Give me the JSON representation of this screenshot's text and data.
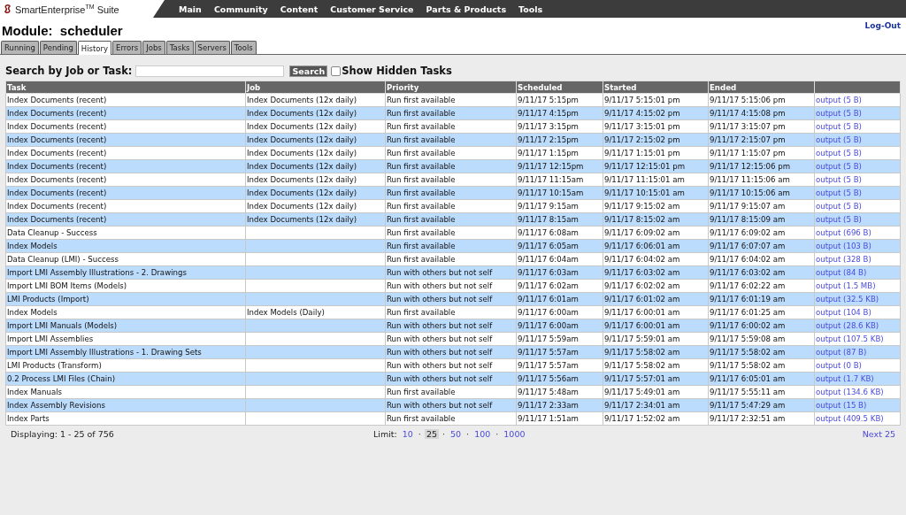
{
  "brand": "SmartEnterprise$^{TM}$ Suite",
  "nav": [
    "Main",
    "Community",
    "Content",
    "Customer Service",
    "Parts & Products",
    "Tools"
  ],
  "module_title": "Module:  scheduler",
  "logout": "Log-Out",
  "tabs": [
    {
      "label": "Running",
      "selected": false
    },
    {
      "label": "Pending",
      "selected": false
    },
    {
      "label": "History",
      "selected": true
    },
    {
      "label": "Errors",
      "selected": false
    },
    {
      "label": "Jobs",
      "selected": false
    },
    {
      "label": "Tasks",
      "selected": false
    },
    {
      "label": "Servers",
      "selected": false
    },
    {
      "label": "Tools",
      "selected": false
    }
  ],
  "search": {
    "label": "Search by Job or Task:",
    "button": "Search",
    "hidden_label": "Show Hidden Tasks",
    "show_hidden": false
  },
  "table": {
    "columns": [
      "Task",
      "Job",
      "Priority",
      "Scheduled",
      "Started",
      "Ended"
    ],
    "rows": [
      {
        "task": "Index Documents (recent)",
        "job": "Index Documents (12x daily)",
        "priority": "Run first available",
        "scheduled": "9/11/17 5:15pm",
        "started": "9/11/17 5:15:01 pm",
        "ended": "9/11/17 5:15:06 pm",
        "output": "output (5 B)"
      },
      {
        "task": "Index Documents (recent)",
        "job": "Index Documents (12x daily)",
        "priority": "Run first available",
        "scheduled": "9/11/17 4:15pm",
        "started": "9/11/17 4:15:02 pm",
        "ended": "9/11/17 4:15:08 pm",
        "output": "output (5 B)"
      },
      {
        "task": "Index Documents (recent)",
        "job": "Index Documents (12x daily)",
        "priority": "Run first available",
        "scheduled": "9/11/17 3:15pm",
        "started": "9/11/17 3:15:01 pm",
        "ended": "9/11/17 3:15:07 pm",
        "output": "output (5 B)"
      },
      {
        "task": "Index Documents (recent)",
        "job": "Index Documents (12x daily)",
        "priority": "Run first available",
        "scheduled": "9/11/17 2:15pm",
        "started": "9/11/17 2:15:02 pm",
        "ended": "9/11/17 2:15:07 pm",
        "output": "output (5 B)"
      },
      {
        "task": "Index Documents (recent)",
        "job": "Index Documents (12x daily)",
        "priority": "Run first available",
        "scheduled": "9/11/17 1:15pm",
        "started": "9/11/17 1:15:01 pm",
        "ended": "9/11/17 1:15:07 pm",
        "output": "output (5 B)"
      },
      {
        "task": "Index Documents (recent)",
        "job": "Index Documents (12x daily)",
        "priority": "Run first available",
        "scheduled": "9/11/17 12:15pm",
        "started": "9/11/17 12:15:01 pm",
        "ended": "9/11/17 12:15:06 pm",
        "output": "output (5 B)"
      },
      {
        "task": "Index Documents (recent)",
        "job": "Index Documents (12x daily)",
        "priority": "Run first available",
        "scheduled": "9/11/17 11:15am",
        "started": "9/11/17 11:15:01 am",
        "ended": "9/11/17 11:15:06 am",
        "output": "output (5 B)"
      },
      {
        "task": "Index Documents (recent)",
        "job": "Index Documents (12x daily)",
        "priority": "Run first available",
        "scheduled": "9/11/17 10:15am",
        "started": "9/11/17 10:15:01 am",
        "ended": "9/11/17 10:15:06 am",
        "output": "output (5 B)"
      },
      {
        "task": "Index Documents (recent)",
        "job": "Index Documents (12x daily)",
        "priority": "Run first available",
        "scheduled": "9/11/17 9:15am",
        "started": "9/11/17 9:15:02 am",
        "ended": "9/11/17 9:15:07 am",
        "output": "output (5 B)"
      },
      {
        "task": "Index Documents (recent)",
        "job": "Index Documents (12x daily)",
        "priority": "Run first available",
        "scheduled": "9/11/17 8:15am",
        "started": "9/11/17 8:15:02 am",
        "ended": "9/11/17 8:15:09 am",
        "output": "output (5 B)"
      },
      {
        "task": "Data Cleanup - Success",
        "priority": "Run first available",
        "scheduled": "9/11/17 6:08am",
        "started": "9/11/17 6:09:02 am",
        "ended": "9/11/17 6:09:02 am",
        "output": "output (696 B)"
      },
      {
        "task": "Index Models",
        "priority": "Run first available",
        "scheduled": "9/11/17 6:05am",
        "started": "9/11/17 6:06:01 am",
        "ended": "9/11/17 6:07:07 am",
        "output": "output (103 B)"
      },
      {
        "task": "Data Cleanup (LMI) - Success",
        "priority": "Run first available",
        "scheduled": "9/11/17 6:04am",
        "started": "9/11/17 6:04:02 am",
        "ended": "9/11/17 6:04:02 am",
        "output": "output (328 B)"
      },
      {
        "task": "Import LMI Assembly Illustrations - 2. Drawings",
        "priority": "Run with others but not self",
        "scheduled": "9/11/17 6:03am",
        "started": "9/11/17 6:03:02 am",
        "ended": "9/11/17 6:03:02 am",
        "output": "output (84 B)"
      },
      {
        "task": "Import LMI BOM Items (Models)",
        "priority": "Run with others but not self",
        "scheduled": "9/11/17 6:02am",
        "started": "9/11/17 6:02:02 am",
        "ended": "9/11/17 6:02:22 am",
        "output": "output (1.5 MB)"
      },
      {
        "task": "LMI Products (Import)",
        "priority": "Run with others but not self",
        "scheduled": "9/11/17 6:01am",
        "started": "9/11/17 6:01:02 am",
        "ended": "9/11/17 6:01:19 am",
        "output": "output (32.5 KB)"
      },
      {
        "task": "Index Models",
        "job": "Index Models (Daily)",
        "priority": "Run first available",
        "scheduled": "9/11/17 6:00am",
        "started": "9/11/17 6:00:01 am",
        "ended": "9/11/17 6:01:25 am",
        "output": "output (104 B)"
      },
      {
        "task": "Import LMI Manuals (Models)",
        "priority": "Run with others but not self",
        "scheduled": "9/11/17 6:00am",
        "started": "9/11/17 6:00:01 am",
        "ended": "9/11/17 6:00:02 am",
        "output": "output (28.6 KB)"
      },
      {
        "task": "Import LMI Assemblies",
        "priority": "Run with others but not self",
        "scheduled": "9/11/17 5:59am",
        "started": "9/11/17 5:59:01 am",
        "ended": "9/11/17 5:59:08 am",
        "output": "output (107.5 KB)"
      },
      {
        "task": "Import LMI Assembly Illustrations - 1. Drawing Sets",
        "priority": "Run with others but not self",
        "scheduled": "9/11/17 5:57am",
        "started": "9/11/17 5:58:02 am",
        "ended": "9/11/17 5:58:02 am",
        "output": "output (87 B)"
      },
      {
        "task": "LMI Products (Transform)",
        "priority": "Run with others but not self",
        "scheduled": "9/11/17 5:57am",
        "started": "9/11/17 5:58:02 am",
        "ended": "9/11/17 5:58:02 am",
        "output": "output (0 B)"
      },
      {
        "task": "0.2 Process LMI Files (Chain)",
        "priority": "Run with others but not self",
        "scheduled": "9/11/17 5:56am",
        "started": "9/11/17 5:57:01 am",
        "ended": "9/11/17 6:05:01 am",
        "output": "output (1.7 KB)"
      },
      {
        "task": "Index Manuals",
        "priority": "Run first available",
        "scheduled": "9/11/17 5:48am",
        "started": "9/11/17 5:49:01 am",
        "ended": "9/11/17 5:55:11 am",
        "output": "output (134.6 KB)"
      },
      {
        "task": "Index Assembly Revisions",
        "priority": "Run with others but not self",
        "scheduled": "9/11/17 2:33am",
        "started": "9/11/17 2:34:01 am",
        "ended": "9/11/17 5:47:29 am",
        "output": "output (15 B)"
      },
      {
        "task": "Index Parts",
        "priority": "Run first available",
        "scheduled": "9/11/17 1:51am",
        "started": "9/11/17 1:52:02 am",
        "ended": "9/11/17 2:32:51 am",
        "output": "output (409.5 KB)"
      }
    ]
  },
  "footer": {
    "displaying": "Displaying: 1 - 25 of 756",
    "limit_label": "Limit:",
    "separator": "·",
    "limits": [
      {
        "label": "10",
        "selected": false
      },
      {
        "label": "25",
        "selected": true
      },
      {
        "label": "50",
        "selected": false
      },
      {
        "label": "100",
        "selected": false
      },
      {
        "label": "1000",
        "selected": false
      }
    ],
    "next": "Next 25"
  }
}
